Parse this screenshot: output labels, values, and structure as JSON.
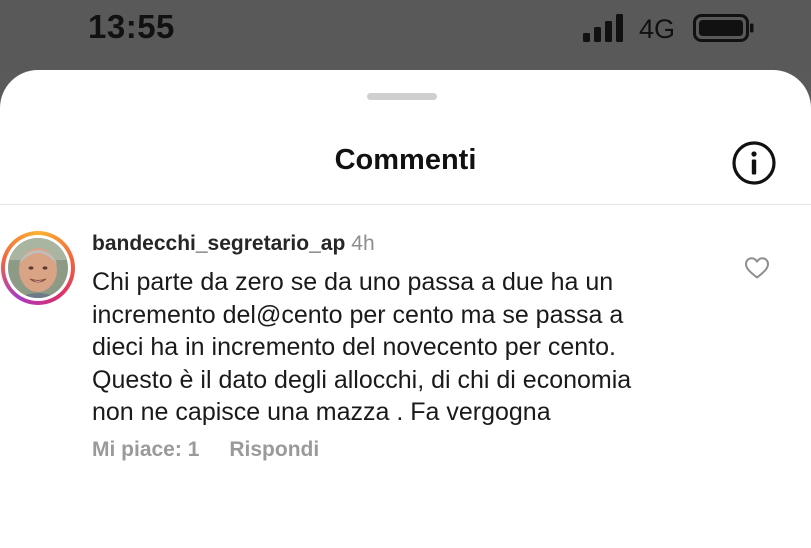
{
  "status_bar": {
    "time": "13:55",
    "network": "4G",
    "signal_icon": "signal-bars-icon",
    "battery_icon": "battery-icon"
  },
  "sheet": {
    "title": "Commenti",
    "info_icon": "info-icon"
  },
  "comment": {
    "username": "bandecchi_segretario_ap",
    "timestamp": "4h",
    "lines": [
      "Chi parte da zero se da uno passa a due ha un",
      "incremento del@cento per cento ma se passa a",
      "dieci ha in incremento del novecento per cento.",
      "Questo è il dato degli allocchi, di chi di economia",
      "non ne capisce una mazza . Fa vergogna"
    ],
    "likes_label": "Mi piace: 1",
    "reply_label": "Rispondi",
    "like_icon": "heart-outline-icon"
  },
  "colors": {
    "status_bar_bg": "#595959",
    "sheet_bg": "#ffffff",
    "muted_text": "#8e8e8e",
    "story_ring": [
      "#f9b233",
      "#d92e6d",
      "#a83bc4"
    ]
  }
}
